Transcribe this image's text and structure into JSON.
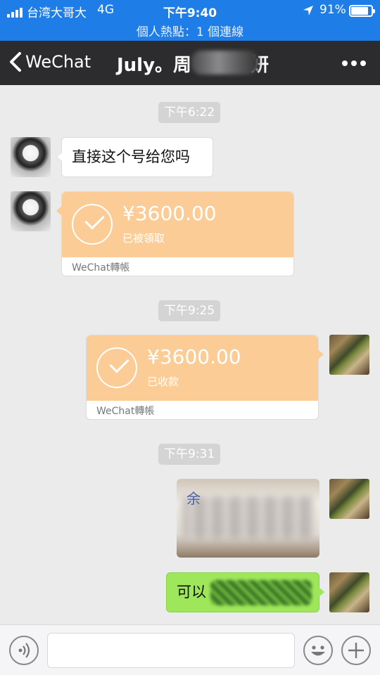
{
  "status_bar": {
    "carrier": "台湾大哥大",
    "network": "4G",
    "time": "下午9:40",
    "battery_percent": "91%",
    "battery_level": 0.91,
    "hotspot_text": "個人熱點：1 個連線"
  },
  "nav": {
    "back_label": "WeChat",
    "title_visible_start": "July。周",
    "title_visible_end": "妍"
  },
  "messages": {
    "ts1": "下午6:22",
    "msg1_text": "直接这个号给您吗",
    "transfer1": {
      "amount": "¥3600.00",
      "status": "已被領取",
      "footer": "WeChat轉帳"
    },
    "ts2": "下午9:25",
    "transfer2": {
      "amount": "¥3600.00",
      "status": "已收款",
      "footer": "WeChat轉帳"
    },
    "ts3": "下午9:31",
    "photo_mark": "余",
    "msg_last_text": "可以"
  },
  "colors": {
    "status_bar": "#1e7de6",
    "nav_bar": "#2c2c2e",
    "chat_bg": "#ebebeb",
    "transfer": "#fbcc96",
    "sent_bubble": "#9fe75a"
  }
}
